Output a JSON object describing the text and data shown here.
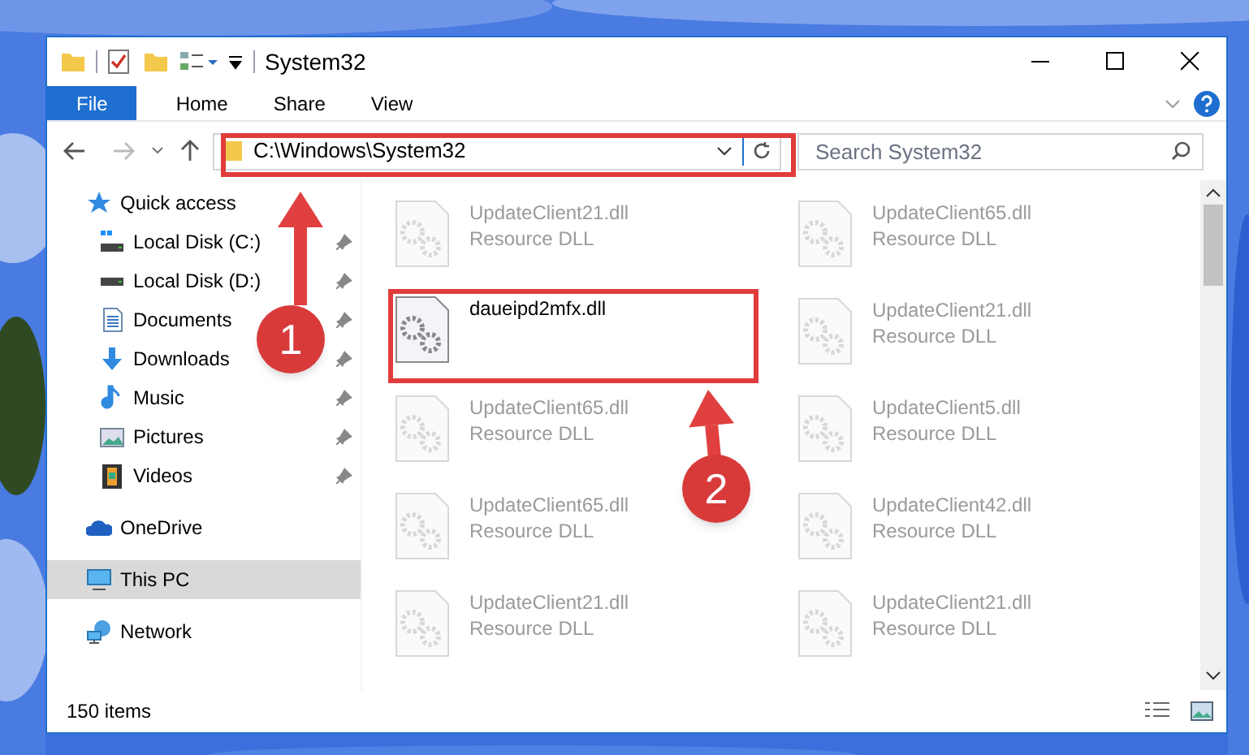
{
  "window": {
    "title": "System32"
  },
  "ribbon_tabs": [
    {
      "label": "File",
      "selected": true
    },
    {
      "label": "Home",
      "selected": false
    },
    {
      "label": "Share",
      "selected": false
    },
    {
      "label": "View",
      "selected": false
    }
  ],
  "address": {
    "path": "C:\\Windows\\System32"
  },
  "search": {
    "placeholder": "Search System32"
  },
  "nav_items": [
    {
      "kind": "quick",
      "label": "Quick access",
      "pinned": false,
      "selected": false
    },
    {
      "kind": "diskc",
      "label": "Local Disk (C:)",
      "pinned": true,
      "selected": false
    },
    {
      "kind": "disk",
      "label": "Local Disk (D:)",
      "pinned": true,
      "selected": false
    },
    {
      "kind": "documents",
      "label": "Documents",
      "pinned": true,
      "selected": false
    },
    {
      "kind": "downloads",
      "label": "Downloads",
      "pinned": true,
      "selected": false
    },
    {
      "kind": "music",
      "label": "Music",
      "pinned": true,
      "selected": false
    },
    {
      "kind": "pictures",
      "label": "Pictures",
      "pinned": true,
      "selected": false
    },
    {
      "kind": "videos",
      "label": "Videos",
      "pinned": true,
      "selected": false
    },
    {
      "kind": "onedrive",
      "label": "OneDrive",
      "pinned": false,
      "selected": false
    },
    {
      "kind": "pc",
      "label": "This PC",
      "pinned": false,
      "selected": true
    },
    {
      "kind": "network",
      "label": "Network",
      "pinned": false,
      "selected": false
    }
  ],
  "files": [
    {
      "name": "UpdateClient21.dll",
      "type": "Resource DLL",
      "blurred": true
    },
    {
      "name": "UpdateClient65.dll",
      "type": "Resource DLL",
      "blurred": true
    },
    {
      "name": "daueipd2mfx.dll",
      "blurred": false
    },
    {
      "name": "UpdateClient21.dll",
      "type": "Resource DLL",
      "blurred": true
    },
    {
      "name": "UpdateClient65.dll",
      "type": "Resource DLL",
      "blurred": true
    },
    {
      "name": "UpdateClient5.dll",
      "type": "Resource DLL",
      "blurred": true
    },
    {
      "name": "UpdateClient65.dll",
      "type": "Resource DLL",
      "blurred": true
    },
    {
      "name": "UpdateClient42.dll",
      "type": "Resource DLL",
      "blurred": true
    },
    {
      "name": "UpdateClient21.dll",
      "type": "Resource DLL",
      "blurred": true
    },
    {
      "name": "UpdateClient21.dll",
      "type": "Resource DLL",
      "blurred": true
    }
  ],
  "status_bar": {
    "count": "150 items"
  },
  "annotations": [
    {
      "number": "1"
    },
    {
      "number": "2"
    }
  ]
}
